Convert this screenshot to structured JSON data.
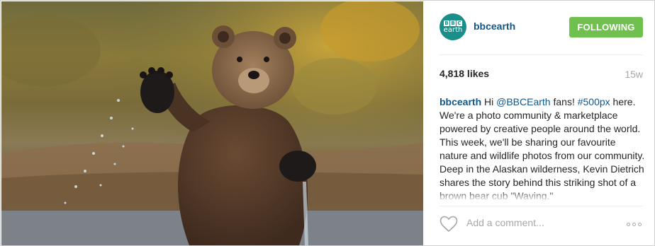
{
  "post": {
    "image_alt": "Bear cub standing in water waving",
    "header": {
      "avatar_text_top": [
        "B",
        "B",
        "C"
      ],
      "avatar_text_bottom": "earth",
      "username": "bbcearth",
      "follow_label": "FOLLOWING"
    },
    "stats": {
      "likes": "4,818 likes",
      "age": "15w"
    },
    "caption": {
      "user": "bbcearth",
      "text_1": " Hi ",
      "mention": "@BBCEarth",
      "text_2": " fans! ",
      "hashtag": "#500px",
      "text_3": " here. We're a photo community & marketplace powered by creative people around the world. This week, we'll be sharing our favourite nature and wildlife photos from our community.",
      "text_4": "Deep in the Alaskan wilderness, Kevin Dietrich shares the story behind this striking shot of a brown bear cub \"Waving.\""
    },
    "actions": {
      "comment_placeholder": "Add a comment..."
    },
    "colors": {
      "follow_green": "#70c050",
      "link_blue": "#125688",
      "muted": "#a5a7aa"
    }
  }
}
